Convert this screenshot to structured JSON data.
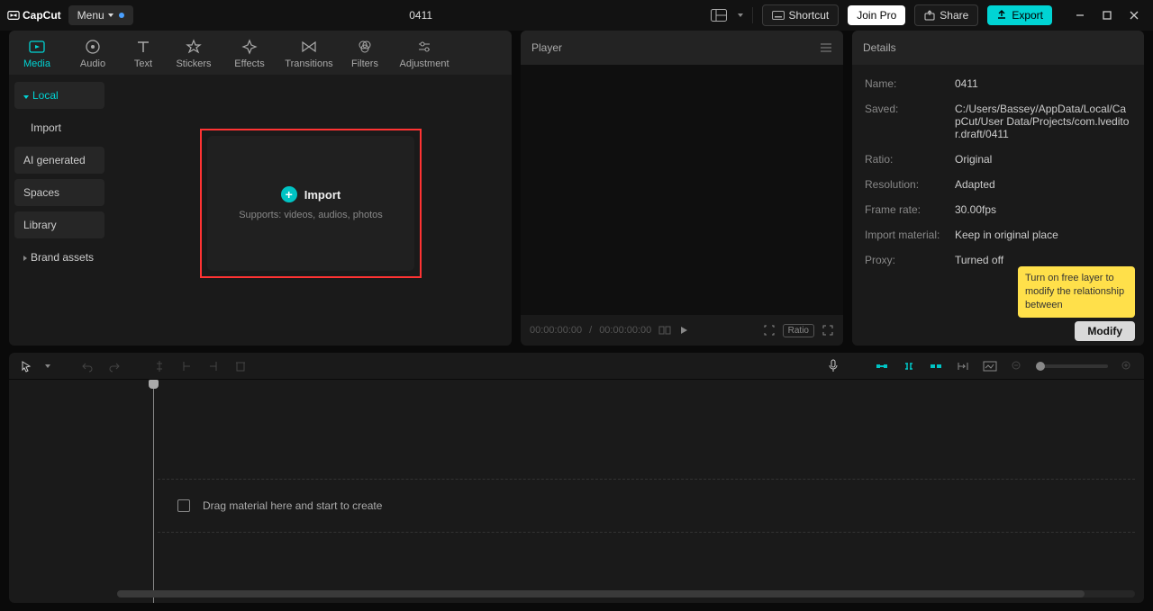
{
  "titlebar": {
    "app_name": "CapCut",
    "menu_label": "Menu",
    "project_title": "0411",
    "shortcut_label": "Shortcut",
    "join_pro_label": "Join Pro",
    "share_label": "Share",
    "export_label": "Export"
  },
  "top_tabs": {
    "media": "Media",
    "audio": "Audio",
    "text": "Text",
    "stickers": "Stickers",
    "effects": "Effects",
    "transitions": "Transitions",
    "filters": "Filters",
    "adjustment": "Adjustment"
  },
  "sidebar": {
    "local": "Local",
    "import": "Import",
    "ai": "AI generated",
    "spaces": "Spaces",
    "library": "Library",
    "brand": "Brand assets"
  },
  "import_box": {
    "title": "Import",
    "subtitle": "Supports: videos, audios, photos"
  },
  "player": {
    "header": "Player",
    "time_current": "00:00:00:00",
    "time_sep": " / ",
    "time_total": "00:00:00:00",
    "ratio_label": "Ratio"
  },
  "details": {
    "header": "Details",
    "rows": {
      "name_label": "Name:",
      "name_value": "0411",
      "saved_label": "Saved:",
      "saved_value": "C:/Users/Bassey/AppData/Local/CapCut/User Data/Projects/com.lveditor.draft/0411",
      "ratio_label": "Ratio:",
      "ratio_value": "Original",
      "resolution_label": "Resolution:",
      "resolution_value": "Adapted",
      "frame_label": "Frame rate:",
      "frame_value": "30.00fps",
      "import_label": "Import material:",
      "import_value": "Keep in original place",
      "proxy_label": "Proxy:",
      "proxy_value": "Turned off"
    },
    "tooltip": "Turn on free layer to modify the relationship between",
    "modify_label": "Modify"
  },
  "timeline": {
    "track_hint": "Drag material here and start to create"
  },
  "colors": {
    "accent": "#00d4d4",
    "highlight_border": "#f33",
    "tooltip_bg": "#ffe04a"
  }
}
